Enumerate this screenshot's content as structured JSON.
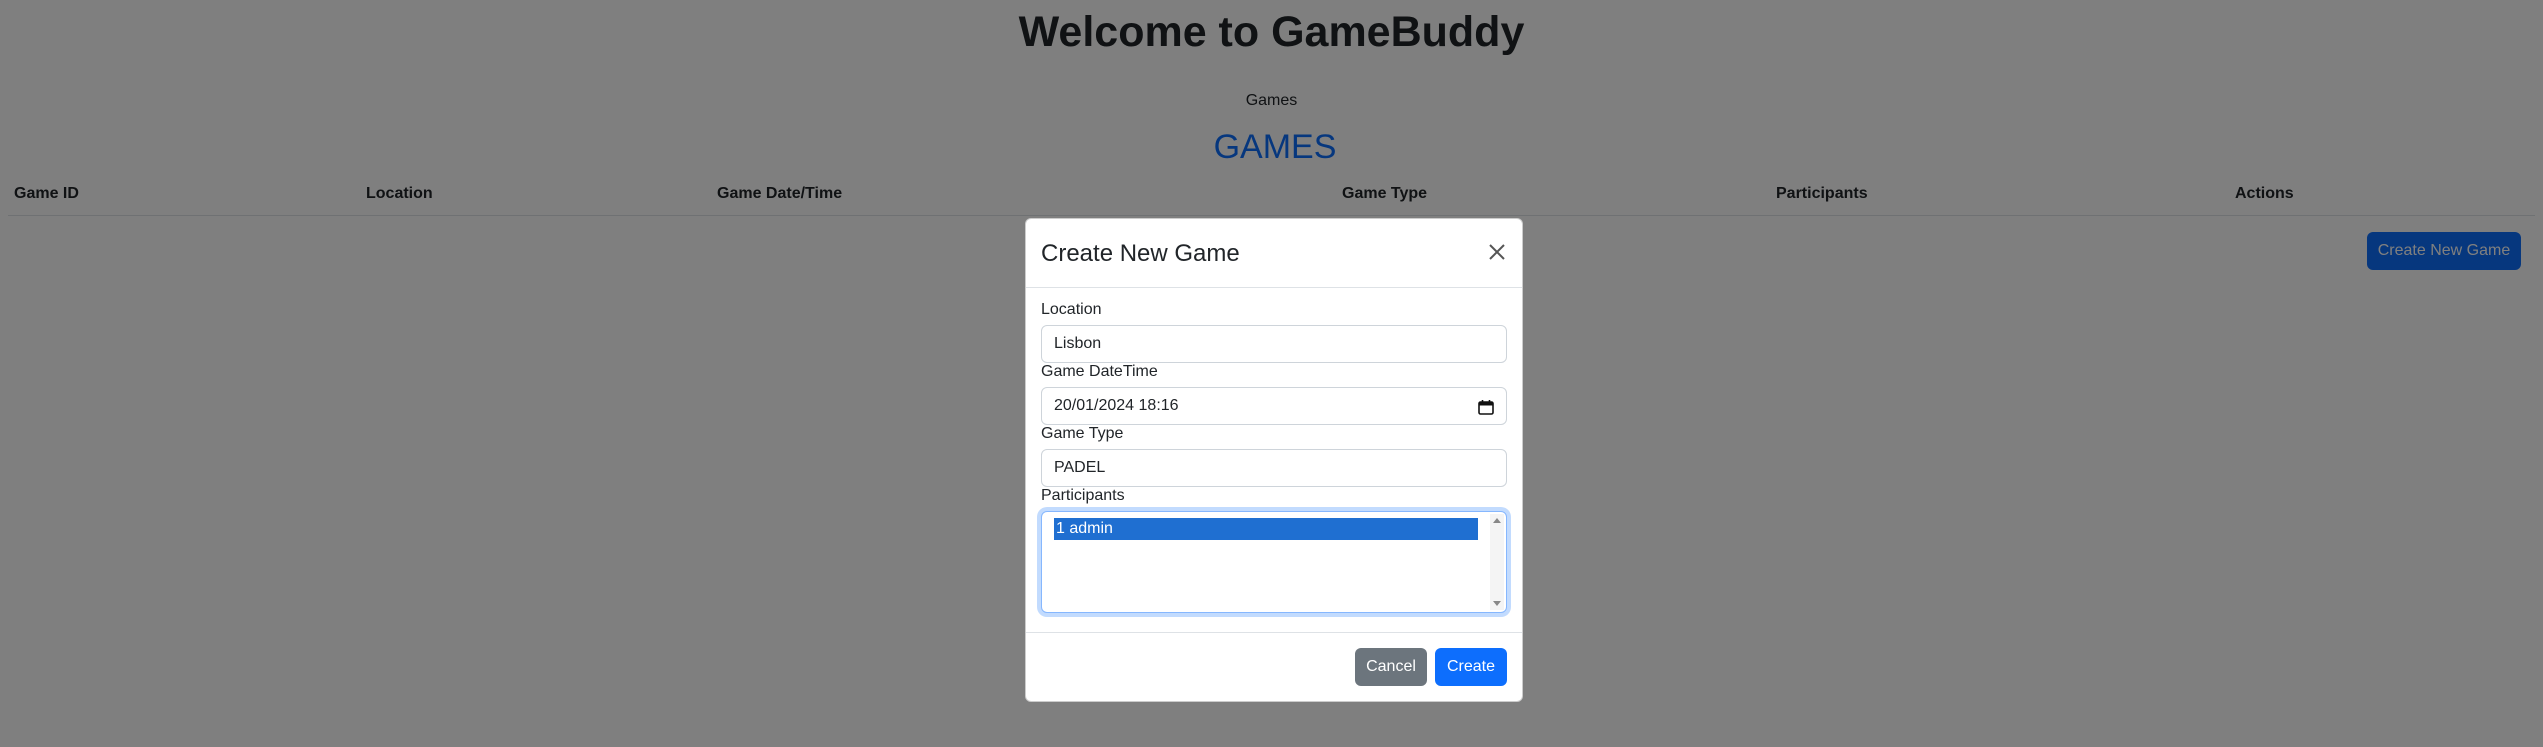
{
  "header": {
    "title": "Welcome to GameBuddy",
    "nav_games": "Games"
  },
  "games_section": {
    "title": "GAMES",
    "columns": [
      "Game ID",
      "Location",
      "Game Date/Time",
      "Game Type",
      "Participants",
      "Actions"
    ],
    "create_button": "Create New Game"
  },
  "modal": {
    "title": "Create New Game",
    "close_icon": "close-icon",
    "fields": {
      "location": {
        "label": "Location",
        "value": "Lisbon"
      },
      "datetime": {
        "label": "Game DateTime",
        "value": "20/01/2024 18:16",
        "icon": "calendar-icon"
      },
      "game_type": {
        "label": "Game Type",
        "value": "PADEL"
      },
      "participants": {
        "label": "Participants",
        "options": [
          "1 admin"
        ],
        "selected": "1 admin"
      }
    },
    "cancel_label": "Cancel",
    "create_label": "Create"
  },
  "colors": {
    "primary": "#0d6efd",
    "secondary": "#6c757d",
    "backdrop": "rgba(0,0,0,0.5)",
    "selected_option": "#1f6fd1"
  }
}
